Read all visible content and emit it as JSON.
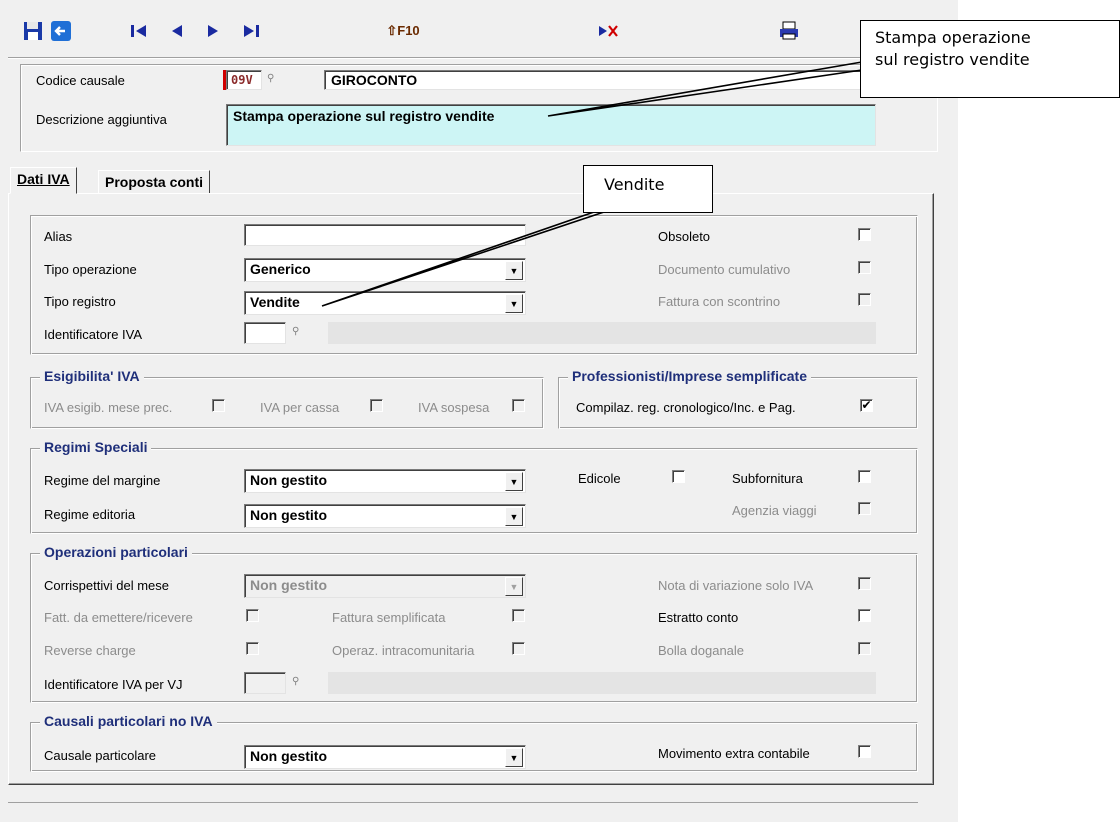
{
  "toolbar": {
    "buttons": [
      "save-icon",
      "exit-icon",
      "first-record-icon",
      "previous-record-icon",
      "next-record-icon",
      "last-record-icon",
      "shift-f10-icon",
      "delete-icon",
      "print-icon"
    ],
    "shift_f10_label": "⇧F10"
  },
  "header": {
    "codice_label": "Codice causale",
    "codice_value": "09V",
    "codice_desc": "GIROCONTO",
    "descr_label": "Descrizione aggiuntiva",
    "descr_value": "Stampa operazione sul registro vendite"
  },
  "tabs": [
    {
      "label": "Dati IVA",
      "active": true
    },
    {
      "label": "Proposta conti",
      "active": false
    }
  ],
  "dati": {
    "alias_label": "Alias",
    "alias_value": "",
    "tipo_op_label": "Tipo operazione",
    "tipo_op_value": "Generico",
    "tipo_reg_label": "Tipo registro",
    "tipo_reg_value": "Vendite",
    "ident_label": "Identificatore IVA",
    "ident_value": "",
    "obsoleto_label": "Obsoleto",
    "doc_cum_label": "Documento cumulativo",
    "fatt_scontrino_label": "Fattura con scontrino"
  },
  "esig": {
    "title": "Esigibilita' IVA",
    "mese_prec": "IVA esigib. mese prec.",
    "per_cassa": "IVA per cassa",
    "sospesa": "IVA sospesa"
  },
  "prof": {
    "title": "Professionisti/Imprese semplificate",
    "compilaz": "Compilaz. reg. cronologico/Inc. e Pag.",
    "compilaz_checked": true
  },
  "regimi": {
    "title": "Regimi Speciali",
    "margine_label": "Regime del margine",
    "margine_value": "Non gestito",
    "editoria_label": "Regime editoria",
    "editoria_value": "Non gestito",
    "edicole": "Edicole",
    "subfornitura": "Subfornitura",
    "agenzia": "Agenzia viaggi"
  },
  "oper": {
    "title": "Operazioni particolari",
    "corrisp_label": "Corrispettivi del mese",
    "corrisp_value": "Non gestito",
    "fatt_emettere": "Fatt. da emettere/ricevere",
    "fatt_sempl": "Fattura semplificata",
    "reverse": "Reverse charge",
    "intracom": "Operaz. intracomunitaria",
    "ident_vj_label": "Identificatore IVA per VJ",
    "nota_var": "Nota di variazione solo IVA",
    "estratto": "Estratto conto",
    "bolla": "Bolla doganale"
  },
  "causali": {
    "title": "Causali particolari no IVA",
    "causale_label": "Causale particolare",
    "causale_value": "Non gestito",
    "extra_label": "Movimento extra contabile"
  },
  "callouts": {
    "stampa_line1": "Stampa operazione",
    "stampa_line2": "sul registro vendite",
    "vendite": "Vendite"
  },
  "colors": {
    "descr_bg": "#cdf5f5",
    "group_title": "#1f2f7a",
    "code_marker": "#d00000"
  }
}
